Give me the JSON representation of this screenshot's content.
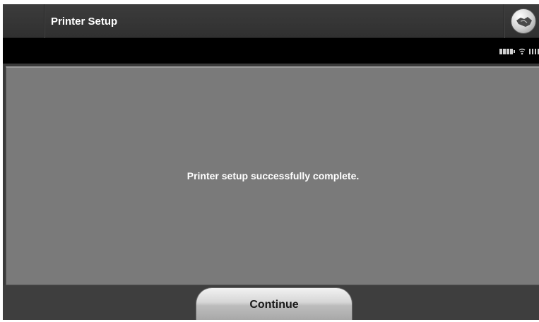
{
  "header": {
    "title": "Printer Setup",
    "logo_icon": "handshake-logo-icon"
  },
  "status": {
    "icons": [
      "battery-icon",
      "wifi-icon",
      "signal-icon"
    ]
  },
  "main": {
    "message": "Printer setup successfully complete."
  },
  "footer": {
    "continue_label": "Continue"
  },
  "colors": {
    "titlebar": "#353535",
    "statusbar": "#000000",
    "content": "#7a7a7a",
    "footer": "#3e3e3e",
    "button": "#d0d0d0"
  }
}
